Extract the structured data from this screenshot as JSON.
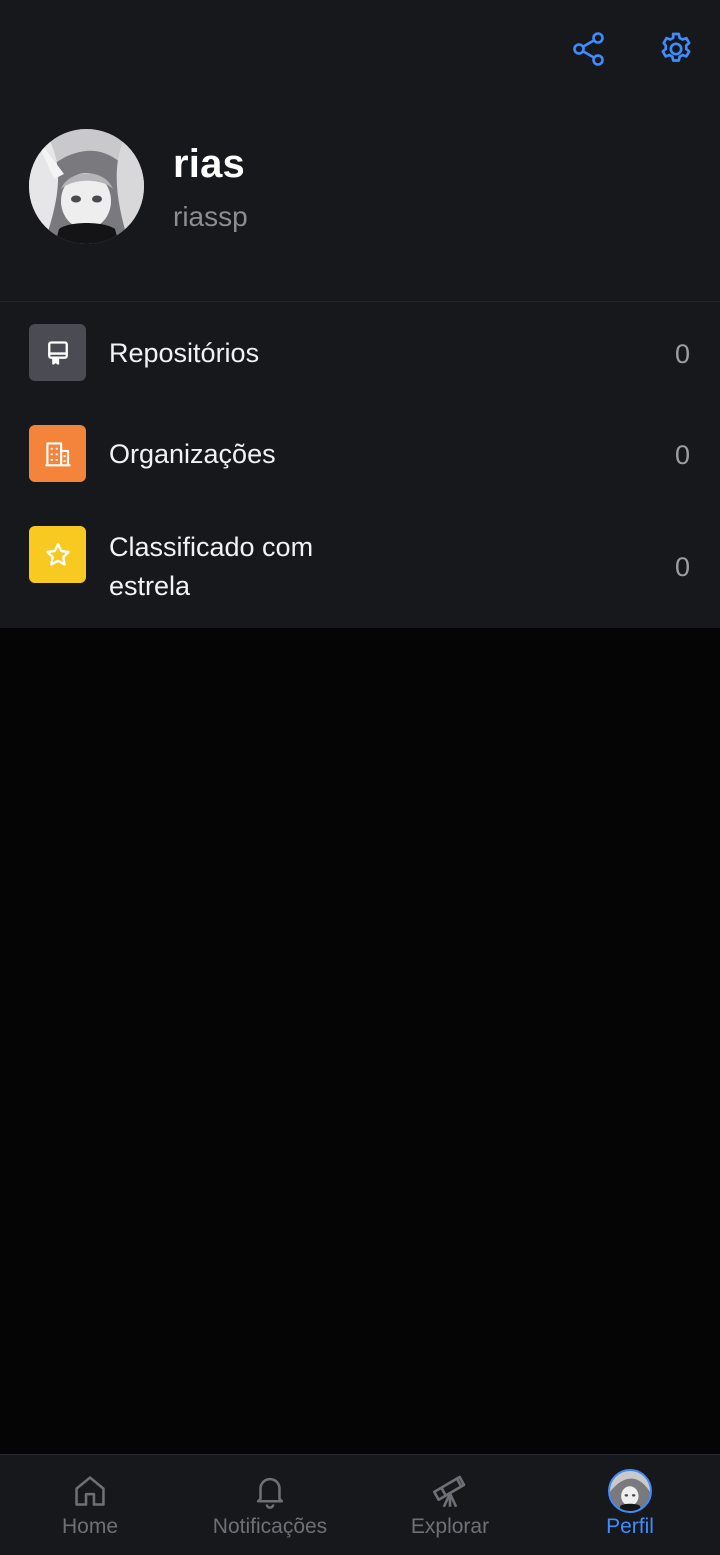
{
  "header": {
    "share_icon": "share-icon",
    "settings_icon": "gear-icon",
    "accent": "#3f8cff"
  },
  "profile": {
    "display_name": "rias",
    "username": "riassp"
  },
  "menu": {
    "items": [
      {
        "label": "Repositórios",
        "count": "0",
        "icon": "repo-icon",
        "icon_bg": "#4a4b53"
      },
      {
        "label": "Organizações",
        "count": "0",
        "icon": "organization-icon",
        "icon_bg": "#f5843b"
      },
      {
        "label": "Classificado com estrela",
        "count": "0",
        "icon": "star-icon",
        "icon_bg": "#f8c921"
      }
    ]
  },
  "bottom_nav": {
    "items": [
      {
        "label": "Home",
        "icon": "home-icon"
      },
      {
        "label": "Notificações",
        "icon": "bell-icon"
      },
      {
        "label": "Explorar",
        "icon": "telescope-icon"
      },
      {
        "label": "Perfil",
        "icon": "avatar",
        "active": true
      }
    ]
  }
}
